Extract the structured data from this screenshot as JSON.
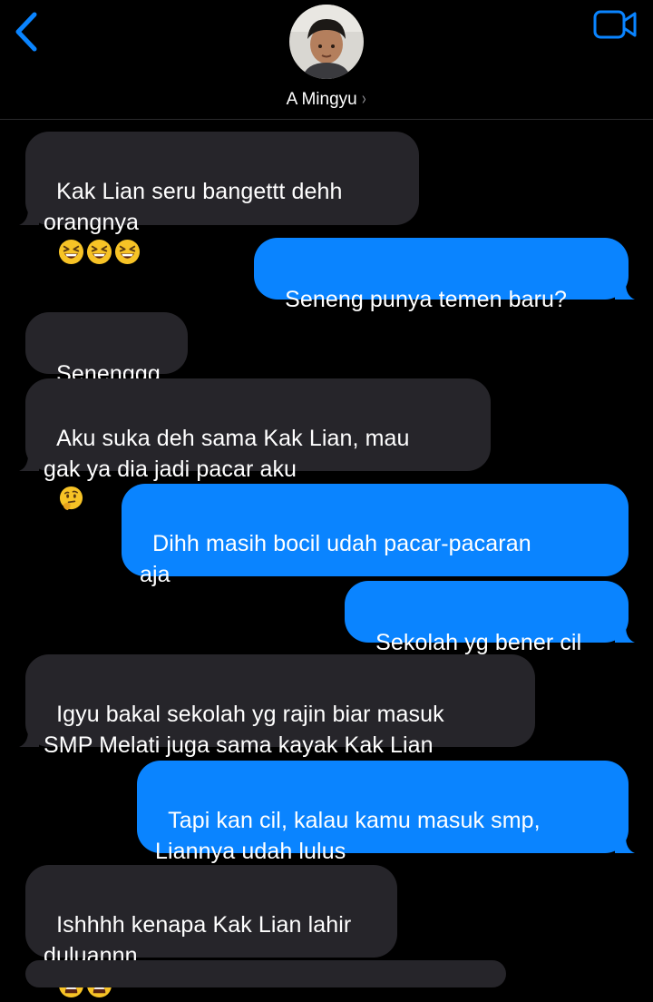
{
  "header": {
    "back_icon": "chevron-left-icon",
    "video_icon": "video-camera-icon",
    "contact_name": "A Mingyu",
    "chevron": "›",
    "accent": "#0a84ff"
  },
  "colors": {
    "received_bubble": "#26252a",
    "sent_bubble": "#0a84ff",
    "background": "#000000"
  },
  "messages": [
    {
      "dir": "received",
      "text": "Kak Lian seru bangettt dehh\norangnya",
      "emoji": [
        "grinning-squinting-face",
        "grinning-squinting-face",
        "grinning-squinting-face"
      ]
    },
    {
      "dir": "sent",
      "text": "Seneng punya temen baru?"
    },
    {
      "dir": "received",
      "text": "Senenggg"
    },
    {
      "dir": "received",
      "text": "Aku suka deh sama Kak Lian, mau\ngak ya dia jadi pacar aku",
      "emoji": [
        "thinking-face"
      ]
    },
    {
      "dir": "sent",
      "text": "Dihh masih bocil udah pacar-pacaran\naja"
    },
    {
      "dir": "sent",
      "text": "Sekolah yg bener cil"
    },
    {
      "dir": "received",
      "text": "Igyu bakal sekolah yg rajin biar masuk\nSMP Melati juga sama kayak Kak Lian"
    },
    {
      "dir": "sent",
      "text": "Tapi kan cil, kalau kamu masuk smp,\nLiannya udah lulus"
    },
    {
      "dir": "received",
      "text": "Ishhhh kenapa Kak Lian lahir\nduluannn",
      "emoji": [
        "tired-face",
        "tired-face"
      ]
    }
  ]
}
